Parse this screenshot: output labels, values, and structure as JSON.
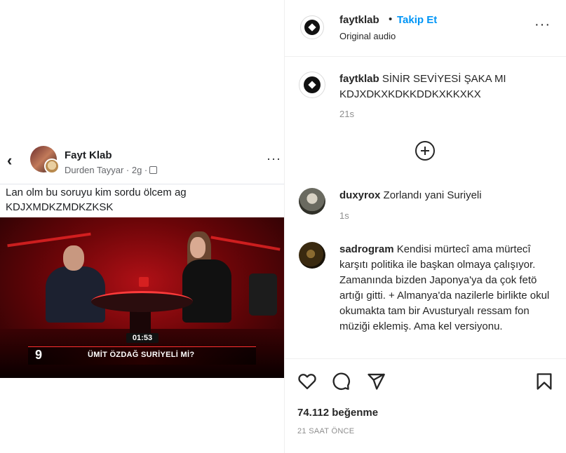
{
  "media": {
    "fb_post": {
      "author": "Fayt Klab",
      "subline": "Durden Tayyar · 2g ·",
      "text": "Lan olm bu soruyu kim sordu ölcem ag KDJXMDKZMDKZKSK",
      "more": "···",
      "back": "‹"
    },
    "video": {
      "timestamp": "01:53",
      "number": "9",
      "caption": "ÜMİT ÖZDAĞ SURİYELİ Mİ?"
    }
  },
  "header": {
    "username": "faytklab",
    "separator": "•",
    "follow_label": "Takip Et",
    "audio": "Original audio",
    "more": "···"
  },
  "caption": {
    "username": "faytklab",
    "text": "SİNİR SEVİYESİ ŞAKA MI KDJXDKXKDKKDDKXKKXKX",
    "time": "21s"
  },
  "comments": [
    {
      "username": "duxyrox",
      "text": "Zorlandı yani Suriyeli",
      "time": "1s"
    },
    {
      "username": "sadrogram",
      "text": "Kendisi mürtecî ama mürtecî karşıtı politika ile başkan olmaya çalışıyor. Zamanında bizden Japonya'ya da çok fetö artığı gitti. + Almanya'da nazilerle birlikte okul okumakta tam bir Avusturyalı ressam fon müziği eklemiş. Ama kel versiyonu."
    }
  ],
  "actions": {
    "likes": "74.112 beğenme",
    "posted_ago": "21 SAAT ÖNCE"
  },
  "colors": {
    "follow": "#0095f6",
    "muted": "#8e8e8e",
    "text": "#262626"
  },
  "icons": [
    "heart-icon",
    "comment-icon",
    "share-icon",
    "bookmark-icon",
    "load-more-icon",
    "more-options-icon"
  ]
}
